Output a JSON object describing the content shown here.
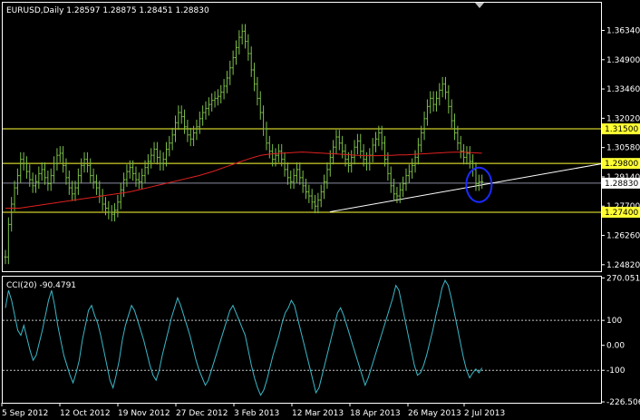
{
  "header": {
    "title": "EURUSD,Daily  1.28597 1.28875 1.28451 1.28830",
    "cci_title": "CCI(20) -90.4791"
  },
  "colors": {
    "background": "#000000",
    "frame": "#ffffff",
    "bull": "#7cbf4a",
    "ma": "#e02020",
    "hline": "#ffff33",
    "trendline": "#ffffff",
    "circle": "#1a2aff",
    "cci": "#3ab8c8",
    "badge_bg": "#ffff33",
    "badge_text": "#000000",
    "current_price_line": "#8a8aa0"
  },
  "chart_data": [
    {
      "type": "line",
      "title": "EURUSD,Daily",
      "ohlc": {
        "open": 1.28597,
        "high": 1.28875,
        "low": 1.28451,
        "close": 1.2883
      },
      "x_ticks": [
        "5 Sep 2012",
        "12 Oct 2012",
        "19 Nov 2012",
        "27 Dec 2012",
        "3 Feb 2013",
        "12 Mar 2013",
        "18 Apr 2013",
        "26 May 2013",
        "2 Jul 2013"
      ],
      "y_ticks": [
        "1.36340",
        "1.34900",
        "1.33460",
        "1.32020",
        "1.30580",
        "1.29140",
        "1.27700",
        "1.26260",
        "1.24820"
      ],
      "ylim": [
        1.245,
        1.377
      ],
      "levels": [
        {
          "value": 1.315,
          "label": "1.31500"
        },
        {
          "value": 1.298,
          "label": "1.29800"
        },
        {
          "value": 1.274,
          "label": "1.27400"
        }
      ],
      "current_price": {
        "value": 1.2883,
        "label": "1.28830"
      },
      "series": [
        {
          "name": "EURUSD",
          "values": [
            1.252,
            1.268,
            1.278,
            1.286,
            1.292,
            1.3,
            1.298,
            1.294,
            1.29,
            1.287,
            1.289,
            1.293,
            1.295,
            1.291,
            1.288,
            1.292,
            1.298,
            1.302,
            1.303,
            1.297,
            1.291,
            1.286,
            1.283,
            1.286,
            1.292,
            1.297,
            1.3,
            1.297,
            1.292,
            1.289,
            1.286,
            1.282,
            1.278,
            1.276,
            1.274,
            1.273,
            1.275,
            1.279,
            1.285,
            1.29,
            1.294,
            1.296,
            1.293,
            1.29,
            1.289,
            1.292,
            1.296,
            1.299,
            1.302,
            1.305,
            1.301,
            1.298,
            1.3,
            1.305,
            1.308,
            1.312,
            1.318,
            1.323,
            1.321,
            1.316,
            1.312,
            1.31,
            1.313,
            1.316,
            1.32,
            1.323,
            1.325,
            1.327,
            1.329,
            1.33,
            1.331,
            1.333,
            1.336,
            1.34,
            1.345,
            1.35,
            1.355,
            1.36,
            1.363,
            1.358,
            1.352,
            1.344,
            1.337,
            1.33,
            1.323,
            1.315,
            1.308,
            1.304,
            1.3,
            1.302,
            1.304,
            1.3,
            1.295,
            1.291,
            1.289,
            1.292,
            1.295,
            1.291,
            1.287,
            1.284,
            1.282,
            1.279,
            1.277,
            1.28,
            1.284,
            1.289,
            1.295,
            1.301,
            1.306,
            1.311,
            1.308,
            1.304,
            1.3,
            1.297,
            1.301,
            1.306,
            1.309,
            1.304,
            1.3,
            1.298,
            1.302,
            1.307,
            1.31,
            1.313,
            1.308,
            1.3,
            1.293,
            1.287,
            1.283,
            1.282,
            1.285,
            1.288,
            1.292,
            1.294,
            1.297,
            1.301,
            1.307,
            1.313,
            1.32,
            1.326,
            1.33,
            1.327,
            1.33,
            1.334,
            1.337,
            1.333,
            1.326,
            1.319,
            1.313,
            1.308,
            1.304,
            1.301,
            1.303,
            1.299,
            1.295,
            1.288,
            1.289,
            1.289
          ]
        },
        {
          "name": "MA",
          "values": [
            1.276,
            1.276,
            1.276,
            1.2765,
            1.277,
            1.2775,
            1.278,
            1.2785,
            1.279,
            1.2795,
            1.28,
            1.2805,
            1.281,
            1.2815,
            1.282,
            1.2825,
            1.283,
            1.2835,
            1.284,
            1.2848,
            1.2856,
            1.2864,
            1.2872,
            1.288,
            1.2888,
            1.2896,
            1.2904,
            1.2912,
            1.292,
            1.293,
            1.294,
            1.2952,
            1.2964,
            1.2976,
            1.2988,
            1.3,
            1.301,
            1.302,
            1.3025,
            1.3028,
            1.303,
            1.3032,
            1.3034,
            1.3036,
            1.3034,
            1.3032,
            1.303,
            1.3028,
            1.3026,
            1.3024,
            1.3022,
            1.302,
            1.3018,
            1.3018,
            1.3018,
            1.302,
            1.302,
            1.3022,
            1.3022,
            1.3024,
            1.3026,
            1.3028,
            1.303,
            1.3032,
            1.3034,
            1.3035,
            1.3035,
            1.3034,
            1.3032,
            1.303
          ]
        }
      ]
    },
    {
      "type": "line",
      "title": "CCI(20)",
      "current_value": -90.4791,
      "y_ticks": [
        "270.051",
        "100",
        "0.00",
        "-100",
        "-226.5064"
      ],
      "ylim": [
        -230,
        275
      ],
      "levels": [
        100,
        -100
      ],
      "series": [
        {
          "name": "CCI(20)",
          "values": [
            150,
            220,
            180,
            120,
            60,
            40,
            80,
            30,
            -20,
            -60,
            -40,
            10,
            60,
            120,
            180,
            220,
            160,
            80,
            20,
            -40,
            -80,
            -120,
            -150,
            -110,
            -60,
            20,
            80,
            140,
            160,
            120,
            90,
            40,
            -20,
            -80,
            -140,
            -170,
            -120,
            -60,
            20,
            80,
            120,
            160,
            140,
            100,
            60,
            20,
            -30,
            -80,
            -120,
            -140,
            -100,
            -40,
            10,
            60,
            110,
            150,
            190,
            160,
            120,
            80,
            40,
            -10,
            -60,
            -100,
            -130,
            -160,
            -140,
            -100,
            -60,
            -20,
            20,
            60,
            100,
            140,
            160,
            130,
            100,
            70,
            40,
            -20,
            -80,
            -130,
            -170,
            -200,
            -180,
            -140,
            -90,
            -40,
            0,
            40,
            90,
            130,
            150,
            180,
            160,
            110,
            60,
            10,
            -40,
            -90,
            -140,
            -190,
            -170,
            -120,
            -70,
            -20,
            30,
            80,
            130,
            150,
            120,
            80,
            40,
            0,
            -40,
            -80,
            -120,
            -160,
            -130,
            -90,
            -50,
            -10,
            30,
            70,
            110,
            150,
            190,
            240,
            220,
            160,
            100,
            40,
            -20,
            -80,
            -120,
            -110,
            -80,
            -40,
            10,
            60,
            120,
            170,
            230,
            260,
            240,
            190,
            130,
            70,
            10,
            -50,
            -100,
            -130,
            -110,
            -95,
            -110,
            -90
          ]
        }
      ]
    }
  ]
}
